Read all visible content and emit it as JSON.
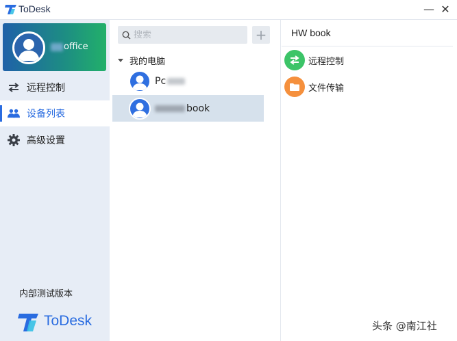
{
  "window": {
    "title": "ToDesk",
    "minimize_glyph": "—",
    "close_glyph": "✕"
  },
  "sidebar": {
    "profile_name": "office",
    "nav": [
      {
        "label": "远程控制",
        "icon": "transfer-arrows-icon",
        "active": false
      },
      {
        "label": "设备列表",
        "icon": "users-icon",
        "active": true
      },
      {
        "label": "高级设置",
        "icon": "gear-icon",
        "active": false
      }
    ],
    "version_label": "内部测试版本",
    "brand_name": "ToDesk"
  },
  "device_list": {
    "search_placeholder": "搜索",
    "add_glyph": "+",
    "group_label": "我的电脑",
    "devices": [
      {
        "name": "Pc",
        "selected": false
      },
      {
        "name": "book",
        "selected": true
      }
    ]
  },
  "detail": {
    "device_name": "HW book",
    "actions": [
      {
        "label": "远程控制",
        "icon": "transfer-arrows-icon"
      },
      {
        "label": "文件传输",
        "icon": "folder-icon"
      }
    ]
  },
  "watermark": "头条 @南江社",
  "colors": {
    "accent": "#2a6ce0",
    "sidebar_bg": "#e7edf6",
    "selected_row": "#d6e1ec",
    "remote_green": "#3cc468",
    "file_orange": "#f5903d"
  }
}
